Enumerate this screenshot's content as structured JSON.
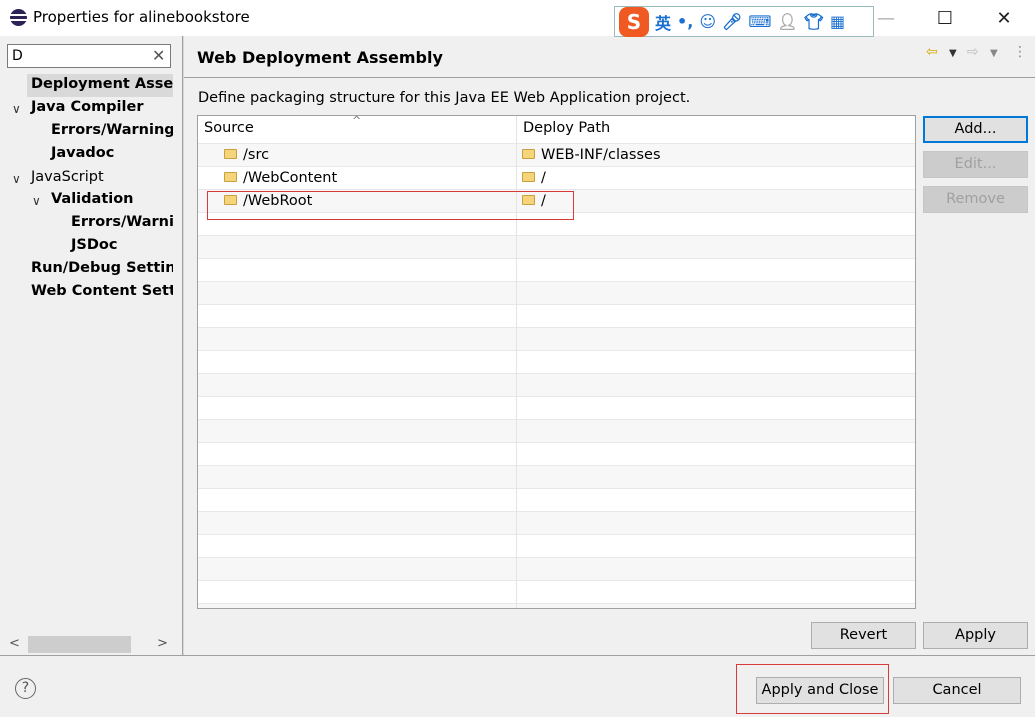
{
  "window": {
    "title": "Properties for alinebookstore",
    "ime": {
      "logo": "S",
      "lang": "英",
      "punct": "•,",
      "icons": [
        "emoji-icon",
        "microphone-icon",
        "keyboard-icon",
        "user-icon",
        "shirt-icon",
        "grid-icon"
      ]
    }
  },
  "sidebar": {
    "filter_value": "D",
    "items": [
      {
        "label": "Deployment Assembly",
        "bold": true,
        "selected": true
      },
      {
        "label": "Java Compiler",
        "bold": true,
        "expanded": true
      },
      {
        "label": "Errors/Warnings",
        "bold": true
      },
      {
        "label": "Javadoc",
        "bold": true
      },
      {
        "label": "JavaScript",
        "bold": false,
        "expanded": true
      },
      {
        "label": "Validation",
        "bold": true,
        "expanded": true
      },
      {
        "label": "Errors/Warnings",
        "bold": true
      },
      {
        "label": "JSDoc",
        "bold": true
      },
      {
        "label": "Run/Debug Settings",
        "bold": true
      },
      {
        "label": "Web Content Settings",
        "bold": true
      }
    ]
  },
  "main": {
    "title": "Web Deployment Assembly",
    "description": "Define packaging structure for this Java EE Web Application project.",
    "table": {
      "columns": [
        "Source",
        "Deploy Path"
      ],
      "rows": [
        {
          "source": "/src",
          "deploy": "WEB-INF/classes"
        },
        {
          "source": "/WebContent",
          "deploy": "/"
        },
        {
          "source": "/WebRoot",
          "deploy": "/"
        }
      ]
    },
    "buttons": {
      "add": "Add...",
      "edit": "Edit...",
      "remove": "Remove",
      "revert": "Revert",
      "apply": "Apply"
    }
  },
  "footer": {
    "help": "?",
    "apply_close": "Apply and Close",
    "cancel": "Cancel"
  },
  "colors": {
    "highlight_box": "#d83a3a",
    "default_button_border": "#0078d7"
  }
}
